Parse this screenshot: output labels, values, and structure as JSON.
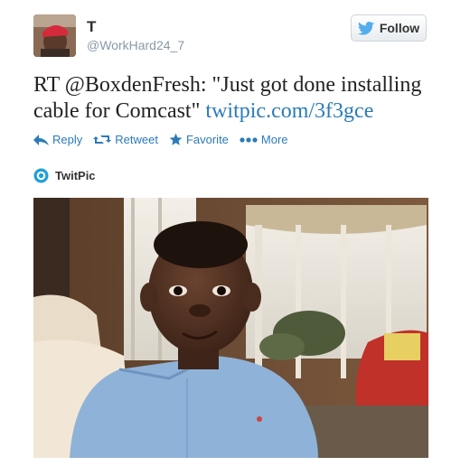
{
  "user": {
    "display_name": "T",
    "handle": "@WorkHard24_7"
  },
  "follow_button": {
    "label": "Follow"
  },
  "tweet": {
    "text": "RT @BoxdenFresh: \"Just got done installing cable for Comcast\" ",
    "link": "twitpic.com/3f3gce"
  },
  "actions": {
    "reply": "Reply",
    "retweet": "Retweet",
    "favorite": "Favorite",
    "more": "More"
  },
  "media": {
    "source": "TwitPic"
  },
  "colors": {
    "link": "#2b7bb9",
    "twitter_blue": "#55acee"
  },
  "icons": [
    "bird-icon",
    "reply-icon",
    "retweet-icon",
    "star-icon",
    "more-icon",
    "twitpic-icon"
  ]
}
